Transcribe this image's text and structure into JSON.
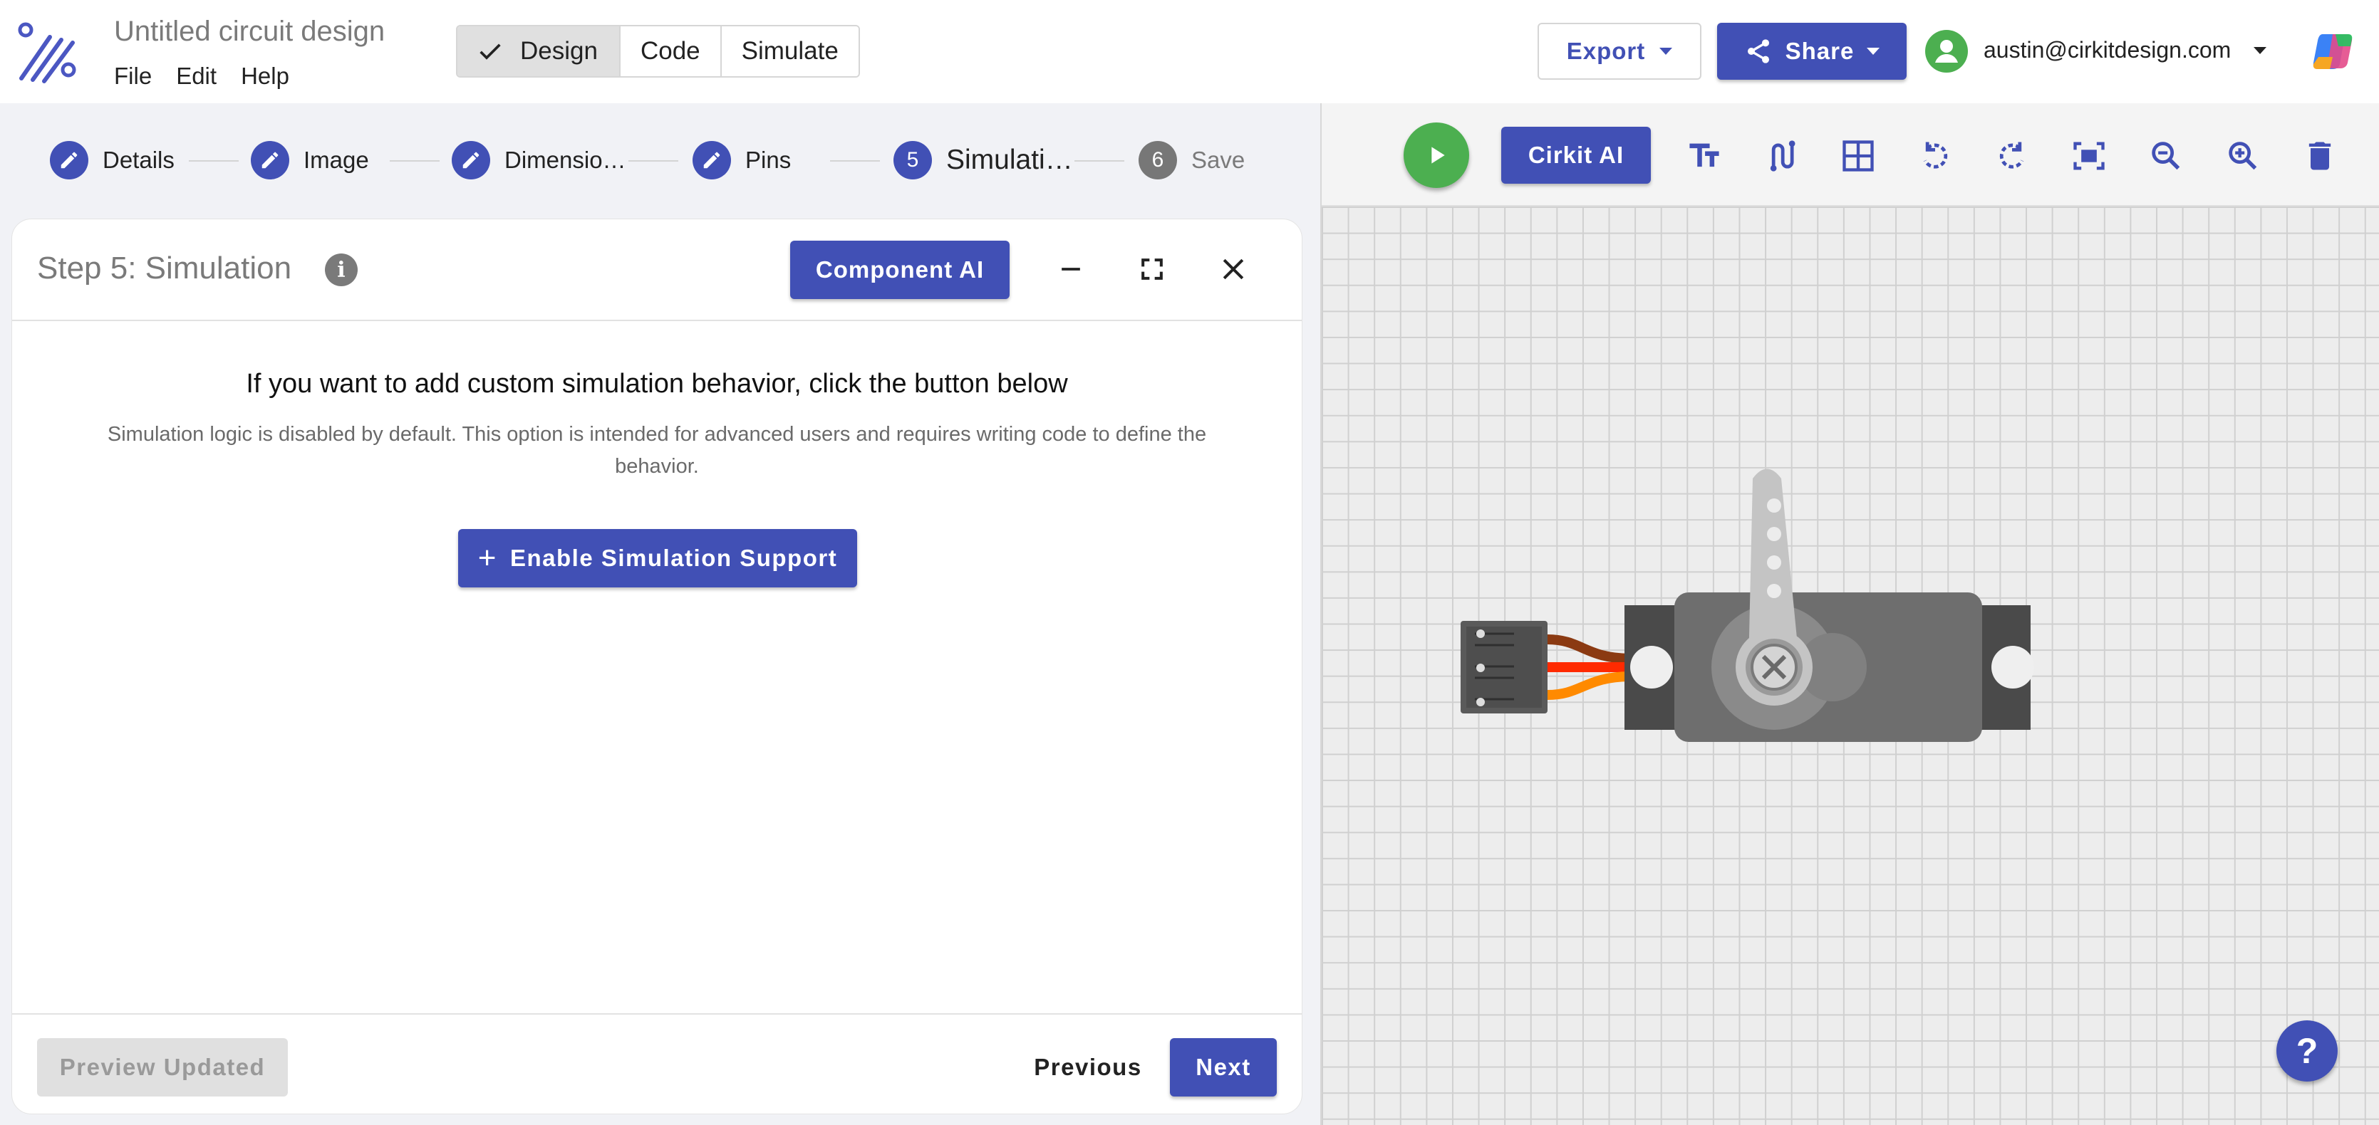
{
  "app": {
    "document_title": "Untitled circuit design",
    "menu": [
      "File",
      "Edit",
      "Help"
    ]
  },
  "mode_tabs": [
    {
      "label": "Design",
      "active": true
    },
    {
      "label": "Code",
      "active": false
    },
    {
      "label": "Simulate",
      "active": false
    }
  ],
  "header_actions": {
    "export_label": "Export",
    "share_label": "Share",
    "user_email": "austin@cirkitdesign.com"
  },
  "stepper": {
    "steps": [
      {
        "label": "Details",
        "marker": "pencil-icon",
        "state": "done"
      },
      {
        "label": "Image",
        "marker": "pencil-icon",
        "state": "done"
      },
      {
        "label": "Dimensio…",
        "marker": "pencil-icon",
        "state": "done"
      },
      {
        "label": "Pins",
        "marker": "pencil-icon",
        "state": "done"
      },
      {
        "label": "Simulati…",
        "number": "5",
        "state": "current"
      },
      {
        "label": "Save",
        "number": "6",
        "state": "upcoming"
      }
    ]
  },
  "panel": {
    "title": "Step 5: Simulation",
    "info_glyph": "i",
    "component_ai_label": "Component AI",
    "heading": "If you want to add custom simulation behavior, click the button below",
    "description": "Simulation logic is disabled by default. This option is intended for advanced users and requires writing code to define the behavior.",
    "enable_label": "Enable Simulation Support",
    "enable_glyph": "+",
    "preview_label": "Preview Updated",
    "previous_label": "Previous",
    "next_label": "Next"
  },
  "canvas": {
    "cirkit_ai_label": "Cirkit AI",
    "tools": [
      "text-size-icon",
      "wire-icon",
      "grid-icon",
      "rotate-left-icon",
      "rotate-right-icon",
      "fit-screen-icon",
      "zoom-out-icon",
      "zoom-in-icon",
      "delete-icon"
    ],
    "help_glyph": "?"
  },
  "colors": {
    "primary": "#4150b5",
    "run_green": "#4caf50",
    "avatar_green": "#4caf50",
    "panel_bg": "#f1f2f6",
    "canvas_bg": "#ededed"
  }
}
